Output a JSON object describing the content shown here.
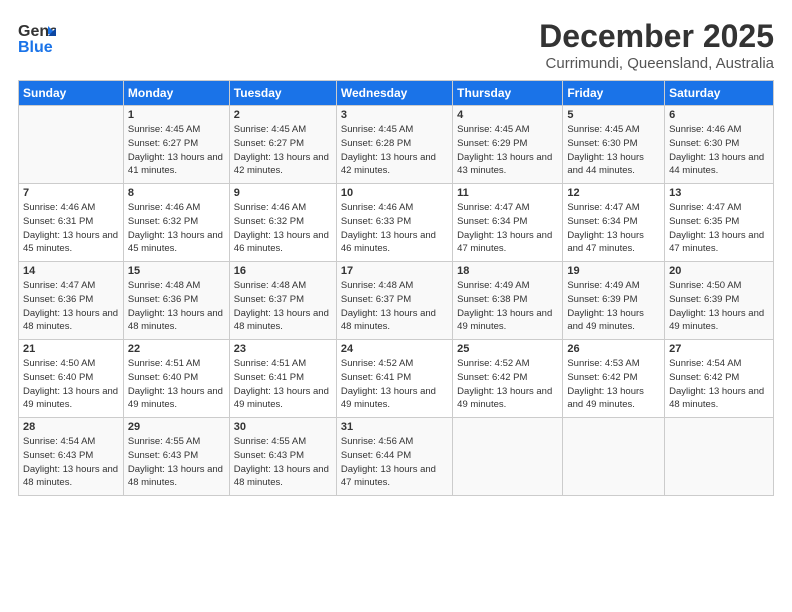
{
  "logo": {
    "line1": "General",
    "line2": "Blue"
  },
  "title": "December 2025",
  "subtitle": "Currimundi, Queensland, Australia",
  "days_header": [
    "Sunday",
    "Monday",
    "Tuesday",
    "Wednesday",
    "Thursday",
    "Friday",
    "Saturday"
  ],
  "weeks": [
    [
      {
        "day": "",
        "sunrise": "",
        "sunset": "",
        "daylight": ""
      },
      {
        "day": "1",
        "sunrise": "Sunrise: 4:45 AM",
        "sunset": "Sunset: 6:27 PM",
        "daylight": "Daylight: 13 hours and 41 minutes."
      },
      {
        "day": "2",
        "sunrise": "Sunrise: 4:45 AM",
        "sunset": "Sunset: 6:27 PM",
        "daylight": "Daylight: 13 hours and 42 minutes."
      },
      {
        "day": "3",
        "sunrise": "Sunrise: 4:45 AM",
        "sunset": "Sunset: 6:28 PM",
        "daylight": "Daylight: 13 hours and 42 minutes."
      },
      {
        "day": "4",
        "sunrise": "Sunrise: 4:45 AM",
        "sunset": "Sunset: 6:29 PM",
        "daylight": "Daylight: 13 hours and 43 minutes."
      },
      {
        "day": "5",
        "sunrise": "Sunrise: 4:45 AM",
        "sunset": "Sunset: 6:30 PM",
        "daylight": "Daylight: 13 hours and 44 minutes."
      },
      {
        "day": "6",
        "sunrise": "Sunrise: 4:46 AM",
        "sunset": "Sunset: 6:30 PM",
        "daylight": "Daylight: 13 hours and 44 minutes."
      }
    ],
    [
      {
        "day": "7",
        "sunrise": "Sunrise: 4:46 AM",
        "sunset": "Sunset: 6:31 PM",
        "daylight": "Daylight: 13 hours and 45 minutes."
      },
      {
        "day": "8",
        "sunrise": "Sunrise: 4:46 AM",
        "sunset": "Sunset: 6:32 PM",
        "daylight": "Daylight: 13 hours and 45 minutes."
      },
      {
        "day": "9",
        "sunrise": "Sunrise: 4:46 AM",
        "sunset": "Sunset: 6:32 PM",
        "daylight": "Daylight: 13 hours and 46 minutes."
      },
      {
        "day": "10",
        "sunrise": "Sunrise: 4:46 AM",
        "sunset": "Sunset: 6:33 PM",
        "daylight": "Daylight: 13 hours and 46 minutes."
      },
      {
        "day": "11",
        "sunrise": "Sunrise: 4:47 AM",
        "sunset": "Sunset: 6:34 PM",
        "daylight": "Daylight: 13 hours and 47 minutes."
      },
      {
        "day": "12",
        "sunrise": "Sunrise: 4:47 AM",
        "sunset": "Sunset: 6:34 PM",
        "daylight": "Daylight: 13 hours and 47 minutes."
      },
      {
        "day": "13",
        "sunrise": "Sunrise: 4:47 AM",
        "sunset": "Sunset: 6:35 PM",
        "daylight": "Daylight: 13 hours and 47 minutes."
      }
    ],
    [
      {
        "day": "14",
        "sunrise": "Sunrise: 4:47 AM",
        "sunset": "Sunset: 6:36 PM",
        "daylight": "Daylight: 13 hours and 48 minutes."
      },
      {
        "day": "15",
        "sunrise": "Sunrise: 4:48 AM",
        "sunset": "Sunset: 6:36 PM",
        "daylight": "Daylight: 13 hours and 48 minutes."
      },
      {
        "day": "16",
        "sunrise": "Sunrise: 4:48 AM",
        "sunset": "Sunset: 6:37 PM",
        "daylight": "Daylight: 13 hours and 48 minutes."
      },
      {
        "day": "17",
        "sunrise": "Sunrise: 4:48 AM",
        "sunset": "Sunset: 6:37 PM",
        "daylight": "Daylight: 13 hours and 48 minutes."
      },
      {
        "day": "18",
        "sunrise": "Sunrise: 4:49 AM",
        "sunset": "Sunset: 6:38 PM",
        "daylight": "Daylight: 13 hours and 49 minutes."
      },
      {
        "day": "19",
        "sunrise": "Sunrise: 4:49 AM",
        "sunset": "Sunset: 6:39 PM",
        "daylight": "Daylight: 13 hours and 49 minutes."
      },
      {
        "day": "20",
        "sunrise": "Sunrise: 4:50 AM",
        "sunset": "Sunset: 6:39 PM",
        "daylight": "Daylight: 13 hours and 49 minutes."
      }
    ],
    [
      {
        "day": "21",
        "sunrise": "Sunrise: 4:50 AM",
        "sunset": "Sunset: 6:40 PM",
        "daylight": "Daylight: 13 hours and 49 minutes."
      },
      {
        "day": "22",
        "sunrise": "Sunrise: 4:51 AM",
        "sunset": "Sunset: 6:40 PM",
        "daylight": "Daylight: 13 hours and 49 minutes."
      },
      {
        "day": "23",
        "sunrise": "Sunrise: 4:51 AM",
        "sunset": "Sunset: 6:41 PM",
        "daylight": "Daylight: 13 hours and 49 minutes."
      },
      {
        "day": "24",
        "sunrise": "Sunrise: 4:52 AM",
        "sunset": "Sunset: 6:41 PM",
        "daylight": "Daylight: 13 hours and 49 minutes."
      },
      {
        "day": "25",
        "sunrise": "Sunrise: 4:52 AM",
        "sunset": "Sunset: 6:42 PM",
        "daylight": "Daylight: 13 hours and 49 minutes."
      },
      {
        "day": "26",
        "sunrise": "Sunrise: 4:53 AM",
        "sunset": "Sunset: 6:42 PM",
        "daylight": "Daylight: 13 hours and 49 minutes."
      },
      {
        "day": "27",
        "sunrise": "Sunrise: 4:54 AM",
        "sunset": "Sunset: 6:42 PM",
        "daylight": "Daylight: 13 hours and 48 minutes."
      }
    ],
    [
      {
        "day": "28",
        "sunrise": "Sunrise: 4:54 AM",
        "sunset": "Sunset: 6:43 PM",
        "daylight": "Daylight: 13 hours and 48 minutes."
      },
      {
        "day": "29",
        "sunrise": "Sunrise: 4:55 AM",
        "sunset": "Sunset: 6:43 PM",
        "daylight": "Daylight: 13 hours and 48 minutes."
      },
      {
        "day": "30",
        "sunrise": "Sunrise: 4:55 AM",
        "sunset": "Sunset: 6:43 PM",
        "daylight": "Daylight: 13 hours and 48 minutes."
      },
      {
        "day": "31",
        "sunrise": "Sunrise: 4:56 AM",
        "sunset": "Sunset: 6:44 PM",
        "daylight": "Daylight: 13 hours and 47 minutes."
      },
      {
        "day": "",
        "sunrise": "",
        "sunset": "",
        "daylight": ""
      },
      {
        "day": "",
        "sunrise": "",
        "sunset": "",
        "daylight": ""
      },
      {
        "day": "",
        "sunrise": "",
        "sunset": "",
        "daylight": ""
      }
    ]
  ]
}
